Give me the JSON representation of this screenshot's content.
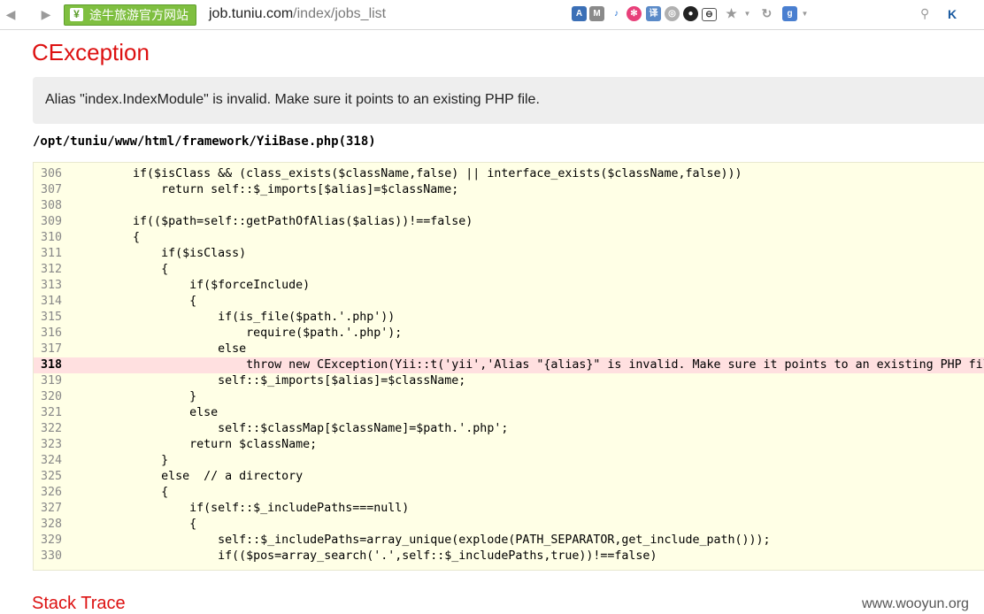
{
  "browser": {
    "site_badge": "途牛旅游官方网站",
    "site_badge_icon": "¥",
    "url_host": "job.tuniu.com",
    "url_path": "/index/jobs_list",
    "k_button": "K"
  },
  "error": {
    "title": "CException",
    "message": "Alias \"index.IndexModule\" is invalid. Make sure it points to an existing PHP file.",
    "file": "/opt/tuniu/www/html/framework/YiiBase.php(318)",
    "error_line": 318
  },
  "code_lines": [
    {
      "n": "306",
      "code": "        if($isClass && (class_exists($className,false) || interface_exists($className,false)))"
    },
    {
      "n": "307",
      "code": "            return self::$_imports[$alias]=$className;"
    },
    {
      "n": "308",
      "code": ""
    },
    {
      "n": "309",
      "code": "        if(($path=self::getPathOfAlias($alias))!==false)"
    },
    {
      "n": "310",
      "code": "        {"
    },
    {
      "n": "311",
      "code": "            if($isClass)"
    },
    {
      "n": "312",
      "code": "            {"
    },
    {
      "n": "313",
      "code": "                if($forceInclude)"
    },
    {
      "n": "314",
      "code": "                {"
    },
    {
      "n": "315",
      "code": "                    if(is_file($path.'.php'))"
    },
    {
      "n": "316",
      "code": "                        require($path.'.php');"
    },
    {
      "n": "317",
      "code": "                    else"
    },
    {
      "n": "318",
      "code": "                        throw new CException(Yii::t('yii','Alias \"{alias}\" is invalid. Make sure it points to an existing PHP file."
    },
    {
      "n": "319",
      "code": "                    self::$_imports[$alias]=$className;"
    },
    {
      "n": "320",
      "code": "                }"
    },
    {
      "n": "321",
      "code": "                else"
    },
    {
      "n": "322",
      "code": "                    self::$classMap[$className]=$path.'.php';"
    },
    {
      "n": "323",
      "code": "                return $className;"
    },
    {
      "n": "324",
      "code": "            }"
    },
    {
      "n": "325",
      "code": "            else  // a directory"
    },
    {
      "n": "326",
      "code": "            {"
    },
    {
      "n": "327",
      "code": "                if(self::$_includePaths===null)"
    },
    {
      "n": "328",
      "code": "                {"
    },
    {
      "n": "329",
      "code": "                    self::$_includePaths=array_unique(explode(PATH_SEPARATOR,get_include_path()));"
    },
    {
      "n": "330",
      "code": "                    if(($pos=array_search('.',self::$_includePaths,true))!==false)"
    }
  ],
  "stack_trace_title": "Stack Trace",
  "watermark": "www.wooyun.org"
}
